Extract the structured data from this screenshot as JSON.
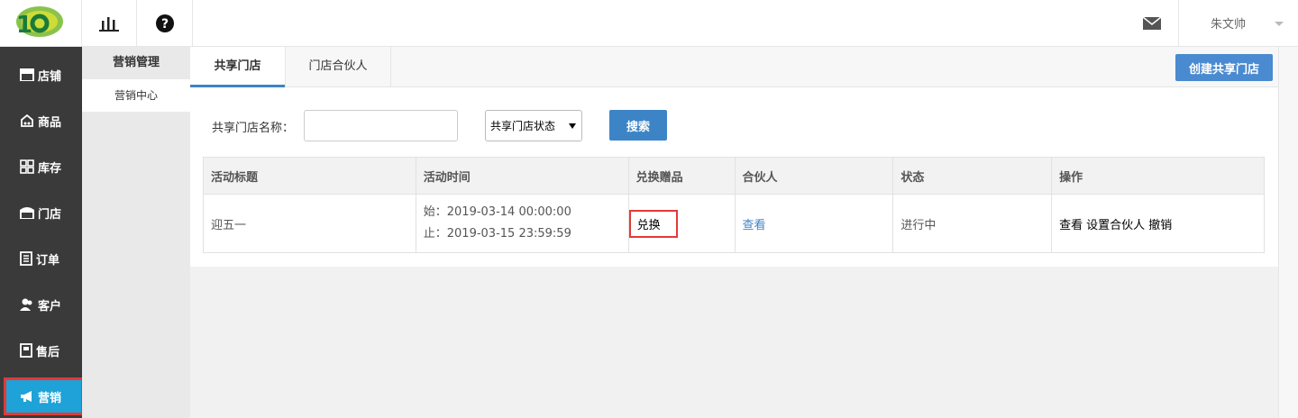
{
  "header": {
    "logo_icon": "brand-logo",
    "stats_icon": "bar-chart-icon",
    "help_icon": "question-circle-icon",
    "mail_icon": "mail-icon",
    "user_name": "朱文帅"
  },
  "sidebar": {
    "items": [
      {
        "label": "店铺",
        "icon": "store-icon"
      },
      {
        "label": "商品",
        "icon": "goods-icon"
      },
      {
        "label": "库存",
        "icon": "grid-icon"
      },
      {
        "label": "门店",
        "icon": "shop-icon"
      },
      {
        "label": "订单",
        "icon": "order-icon"
      },
      {
        "label": "客户",
        "icon": "customer-icon"
      },
      {
        "label": "售后",
        "icon": "aftersale-icon"
      },
      {
        "label": "营销",
        "icon": "megaphone-icon",
        "active": true
      }
    ]
  },
  "subnav": {
    "title": "营销管理",
    "items": [
      "营销中心"
    ]
  },
  "tabs": [
    "共享门店",
    "门店合伙人"
  ],
  "create_button": "创建共享门店",
  "filter": {
    "name_label": "共享门店名称：",
    "name_value": "",
    "status_select": "共享门店状态",
    "search_button": "搜索"
  },
  "table": {
    "headers": [
      "活动标题",
      "活动时间",
      "兑换赠品",
      "合伙人",
      "状态",
      "操作"
    ],
    "rows": [
      {
        "title": "迎五一",
        "start": "始：2019-03-14 00:00:00",
        "end": "止：2019-03-15 23:59:59",
        "gift": "兑换",
        "partner": "查看",
        "status": "进行中",
        "ops": [
          "查看",
          "设置合伙人",
          "撤销"
        ]
      }
    ]
  },
  "colors": {
    "accent": "#3d84c6",
    "sidebar_bg": "#3a3a3a",
    "active_bg": "#1ea2d8",
    "highlight": "#e53935"
  }
}
